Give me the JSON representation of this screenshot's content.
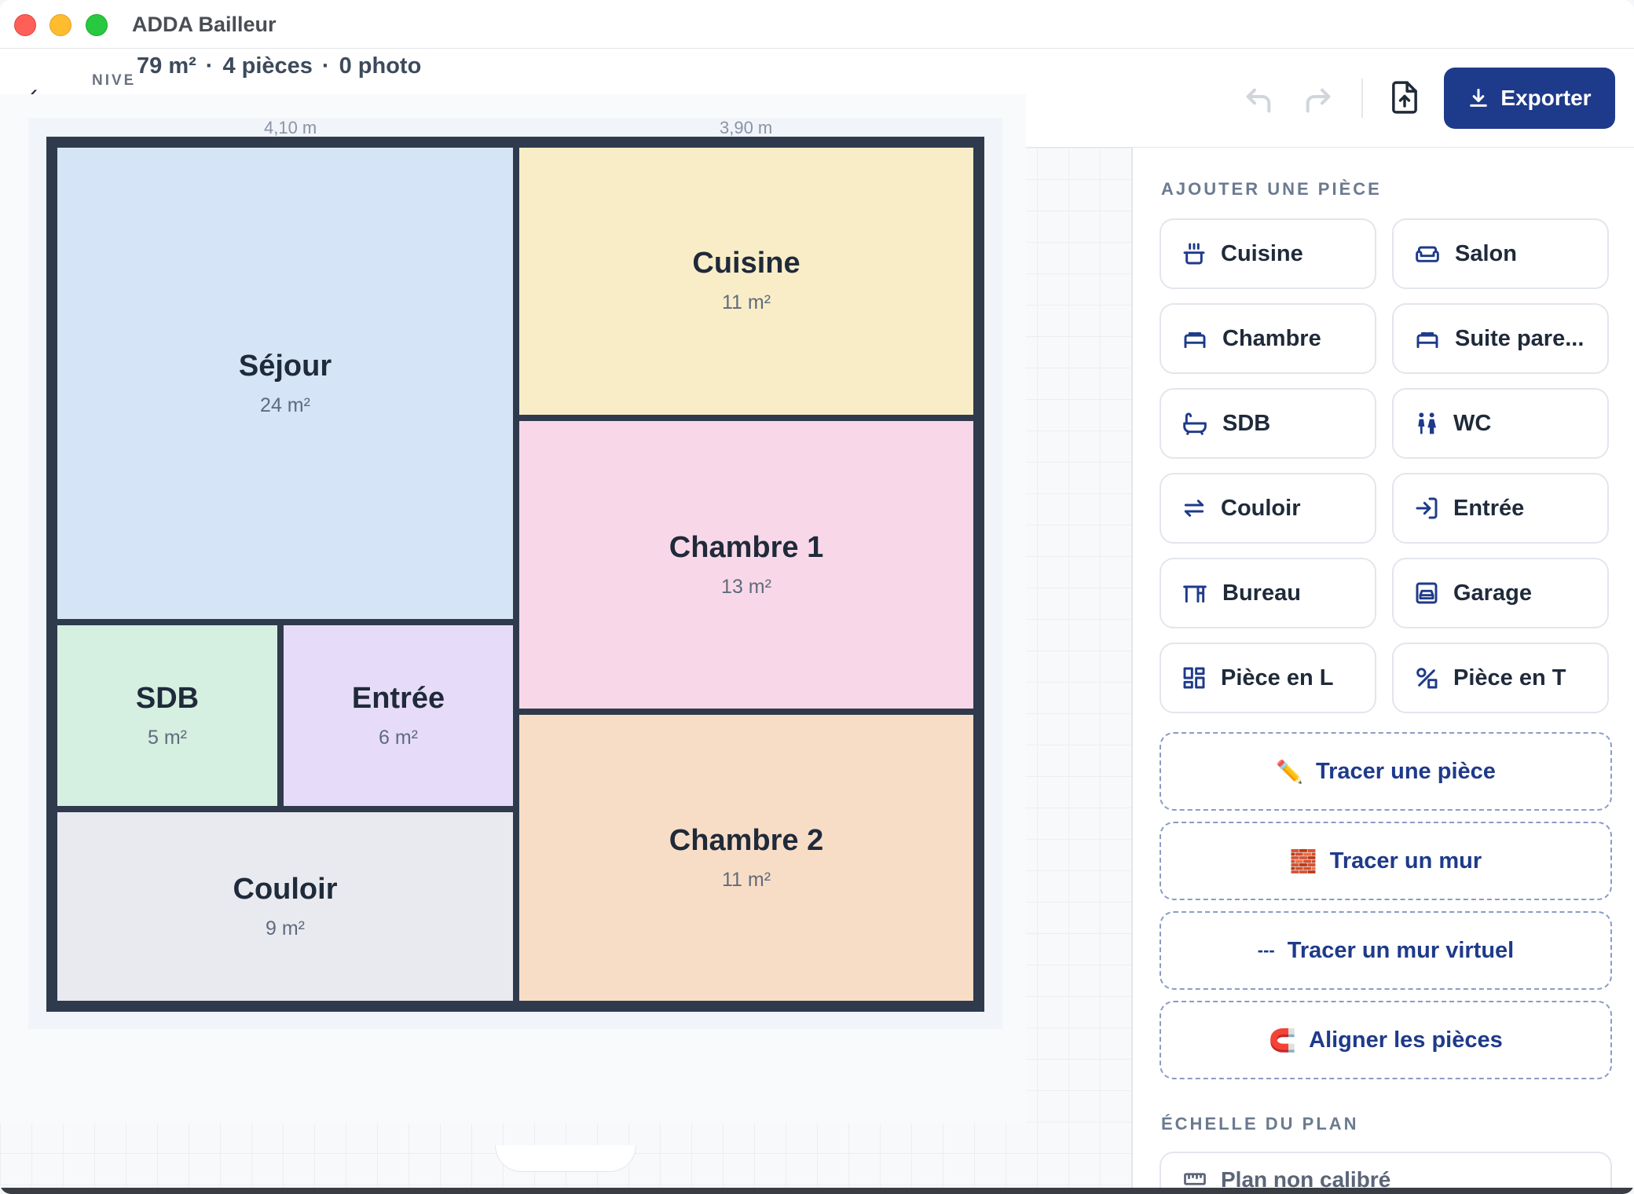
{
  "window": {
    "title": "ADDA Bailleur"
  },
  "toolbar": {
    "back_icon": "arrow-left-icon",
    "level_label": "NIVE",
    "summary": {
      "area": "79 m²",
      "rooms": "4 pièces",
      "photos": "0 photo",
      "separator": "·"
    },
    "undo_icon": "undo-icon",
    "redo_icon": "redo-icon",
    "upload_icon": "file-upload-icon",
    "export_label": "Exporter",
    "accent_color": "#1e3a8a"
  },
  "plan": {
    "dimensions": [
      "4,10 m",
      "3,90 m"
    ],
    "rooms": [
      {
        "name": "Séjour",
        "area": "24 m²",
        "color": "#d6e4f8"
      },
      {
        "name": "Cuisine",
        "area": "11 m²",
        "color": "#f9edc8"
      },
      {
        "name": "Chambre 1",
        "area": "13 m²",
        "color": "#f8d8e8"
      },
      {
        "name": "SDB",
        "area": "5 m²",
        "color": "#d5efe0"
      },
      {
        "name": "Entrée",
        "area": "6 m²",
        "color": "#e6dcfa"
      },
      {
        "name": "Couloir",
        "area": "9 m²",
        "color": "#e8eaf0"
      },
      {
        "name": "Chambre 2",
        "area": "11 m²",
        "color": "#f8ddc6"
      }
    ],
    "wall_color": "#2f3b4c"
  },
  "panel": {
    "add_room_title": "AJOUTER UNE PIÈCE",
    "room_types": [
      {
        "label": "Cuisine",
        "icon": "cooking-pot-icon"
      },
      {
        "label": "Salon",
        "icon": "sofa-icon"
      },
      {
        "label": "Chambre",
        "icon": "bed-icon"
      },
      {
        "label": "Suite pare...",
        "icon": "bed-icon"
      },
      {
        "label": "SDB",
        "icon": "bathtub-icon"
      },
      {
        "label": "WC",
        "icon": "restroom-icon"
      },
      {
        "label": "Couloir",
        "icon": "arrows-left-right-icon"
      },
      {
        "label": "Entrée",
        "icon": "log-in-icon"
      },
      {
        "label": "Bureau",
        "icon": "desk-icon"
      },
      {
        "label": "Garage",
        "icon": "garage-car-icon"
      },
      {
        "label": "Pièce en L",
        "icon": "layout-icon"
      },
      {
        "label": "Pièce en T",
        "icon": "shapes-icon"
      }
    ],
    "tools": [
      {
        "label": "Tracer une pièce",
        "icon": "✏️"
      },
      {
        "label": "Tracer un mur",
        "icon": "🧱"
      },
      {
        "label": "Tracer un mur virtuel",
        "icon": "---"
      },
      {
        "label": "Aligner les pièces",
        "icon": "🧲"
      }
    ],
    "scale_title": "ÉCHELLE DU PLAN",
    "scale_value": "Plan non calibré",
    "scale_icon": "ruler-icon"
  }
}
